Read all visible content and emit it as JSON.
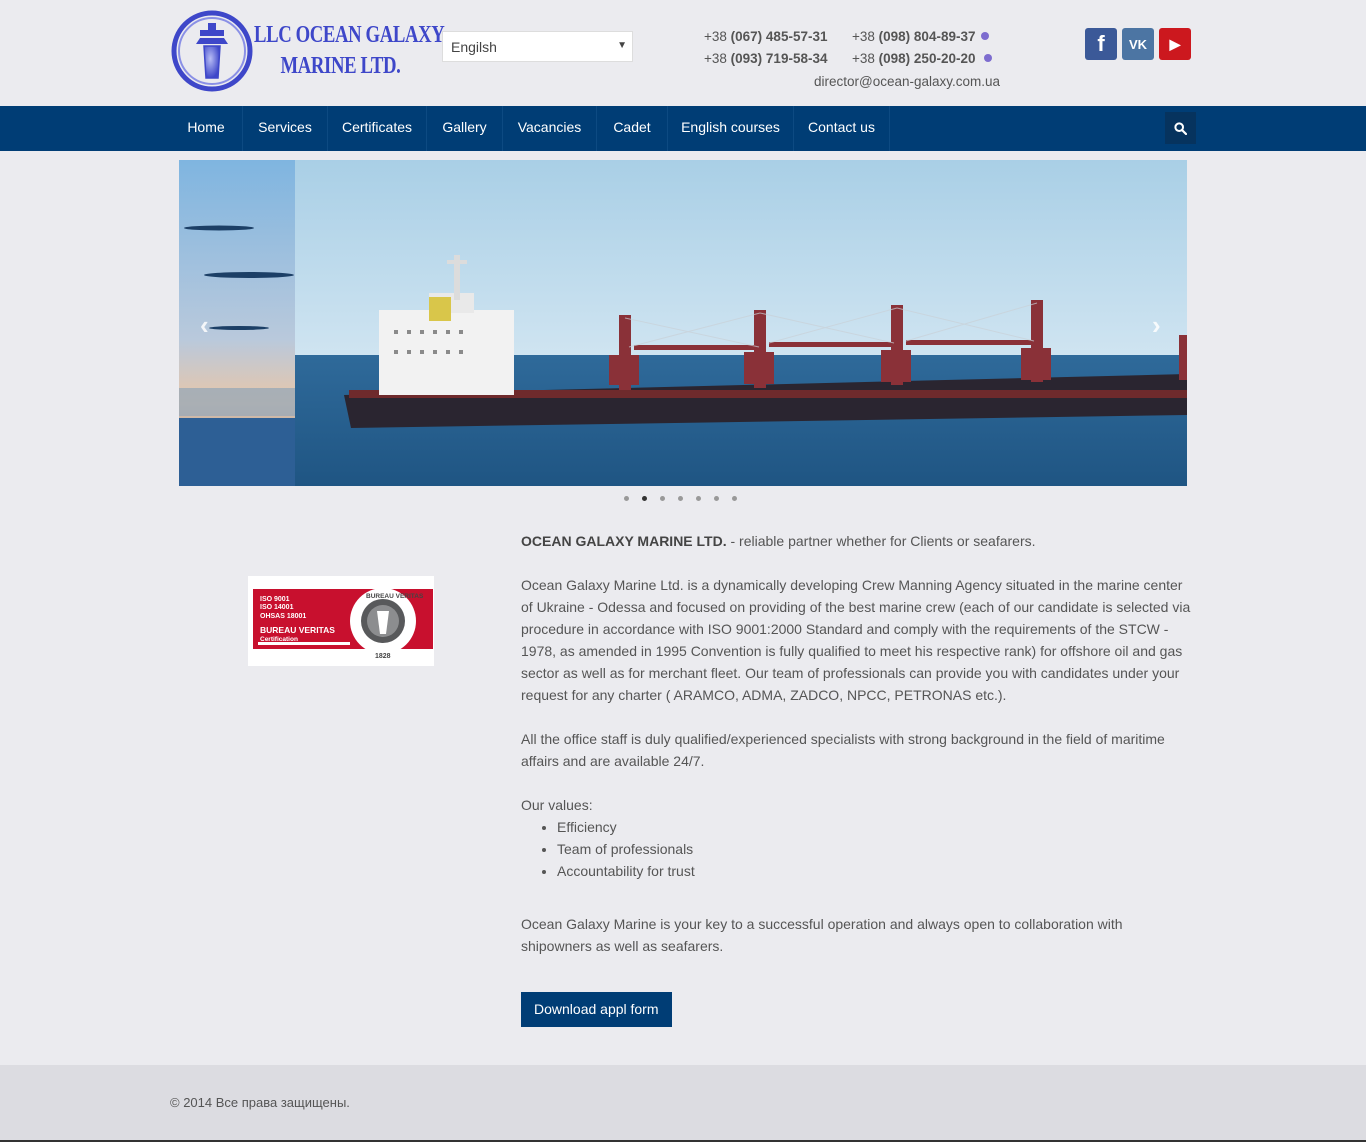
{
  "header": {
    "logo_line1": "LLC OCEAN GALAXY",
    "logo_line2": "MARINE LTD.",
    "language": "Engilsh",
    "phones": [
      {
        "prefix": "+38 ",
        "number": "(067) 485-57-31"
      },
      {
        "prefix": "+38 ",
        "number": "(093) 719-58-34"
      },
      {
        "prefix": "+38 ",
        "number": "(098) 804-89-37"
      },
      {
        "prefix": "+38 ",
        "number": "(098) 250-20-20"
      }
    ],
    "email": "director@ocean-galaxy.com.ua",
    "social": [
      {
        "name": "facebook-icon",
        "glyph": "f",
        "color": "#3b5998"
      },
      {
        "name": "vk-icon",
        "glyph": "VK",
        "color": "#4c75a3"
      },
      {
        "name": "youtube-icon",
        "glyph": "▶",
        "color": "#cc181e"
      }
    ]
  },
  "nav": {
    "items": [
      "Home",
      "Services",
      "Certificates",
      "Gallery",
      "Vacancies",
      "Cadet",
      "English courses",
      "Contact us"
    ],
    "search_icon": "search-icon"
  },
  "slider": {
    "prev_glyph": "‹",
    "next_glyph": "›",
    "slides": 7,
    "active": 2
  },
  "cert": {
    "lines": [
      "ISO 9001",
      "ISO 14001",
      "OHSAS 18001"
    ],
    "name": "BUREAU VERITAS",
    "sub": "Certification",
    "seal_top": "BUREAU VERITAS",
    "year": "1828"
  },
  "content": {
    "intro_bold": "OCEAN GALAXY MARINE LTD.",
    "intro_rest": " - reliable partner whether for Clients or seafarers.",
    "p1": "Ocean Galaxy Marine Ltd. is a dynamically developing Crew Manning Agency situated in the marine center of Ukraine - Odessa and focused on providing of the best marine crew (each of our candidate is selected via procedure in accordance with ISO 9001:2000 Standard and comply with the requirements of the STCW - 1978, as amended in 1995 Convention is fully qualified to meet his respective rank) for offshore oil and gas sector as well as for merchant fleet. Our team of professionals can provide you with candidates under your request for any charter ( ARAMCO, ADMA, ZADCO, NPCC, PETRONAS etc.).",
    "p2": "All the office staff is duly qualified/experienced specialists with strong background in the field of maritime affairs and are available 24/7.",
    "values_title": "Our values:",
    "values": [
      "Efficiency",
      "Team of professionals",
      "Accountability for trust"
    ],
    "p3": "Ocean Galaxy Marine is your key to a successful operation and always open to collaboration with shipowners as well as seafarers.",
    "download_label": "Download appl form"
  },
  "footer": {
    "copyright": "© 2014 Все права защищены."
  },
  "colors": {
    "nav_bg": "#003d75",
    "logo_blue": "#3e47c9",
    "cert_red": "#c8102e"
  }
}
